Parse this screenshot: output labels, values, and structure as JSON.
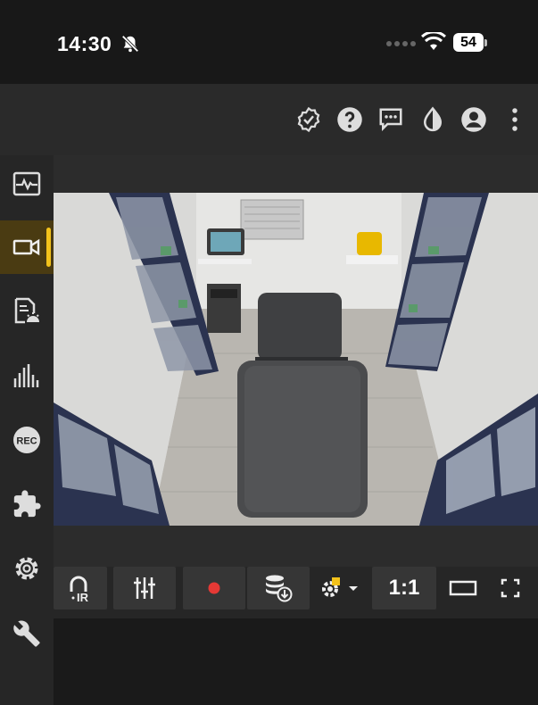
{
  "status_bar": {
    "time": "14:30",
    "battery": "54",
    "icons": [
      "bell-muted-icon",
      "signal-dots-icon",
      "wifi-icon",
      "battery-icon"
    ]
  },
  "header": {
    "icons": [
      "verified-badge-icon",
      "help-icon",
      "chat-icon",
      "contrast-icon",
      "account-icon",
      "more-vert-icon"
    ]
  },
  "sidebar": {
    "items": [
      {
        "icon": "vitals-monitor-icon",
        "active": false
      },
      {
        "icon": "camera-icon",
        "active": true
      },
      {
        "icon": "report-icon",
        "active": false
      },
      {
        "icon": "waveform-icon",
        "active": false
      },
      {
        "icon": "rec-icon",
        "label": "REC",
        "active": false
      },
      {
        "icon": "puzzle-icon",
        "active": false
      },
      {
        "icon": "settings-icon",
        "active": false
      },
      {
        "icon": "wrench-icon",
        "active": false
      }
    ]
  },
  "toolbar": {
    "ir_label": "IR",
    "ratio_label": "1:1",
    "icons": [
      "ir-icon",
      "sliders-icon",
      "record-icon",
      "database-download-icon",
      "camera-settings-icon",
      "aspect-ratio-icon",
      "fullscreen-icon"
    ]
  },
  "colors": {
    "accent": "#f3c21b",
    "active_bg": "#4a3b12",
    "record": "#e53935"
  }
}
